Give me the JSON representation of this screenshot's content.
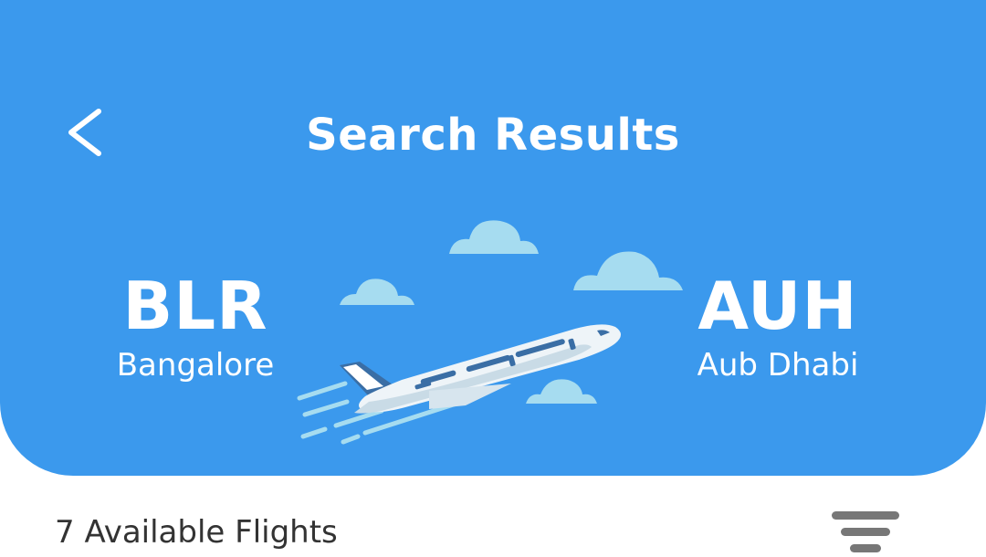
{
  "header": {
    "title": "Search Results",
    "back_icon": "chevron-left-icon",
    "background_color": "#3b99ed"
  },
  "route": {
    "origin": {
      "code": "BLR",
      "city": "Bangalore"
    },
    "destination": {
      "code": "AUH",
      "city": "Aub Dhabi"
    }
  },
  "illustration": {
    "icon": "airplane-icon",
    "cloud_color": "#a6dcf0",
    "tail_color": "#3a6ea5"
  },
  "results": {
    "count_label": "7 Available Flights",
    "filter_icon": "filter-icon"
  }
}
